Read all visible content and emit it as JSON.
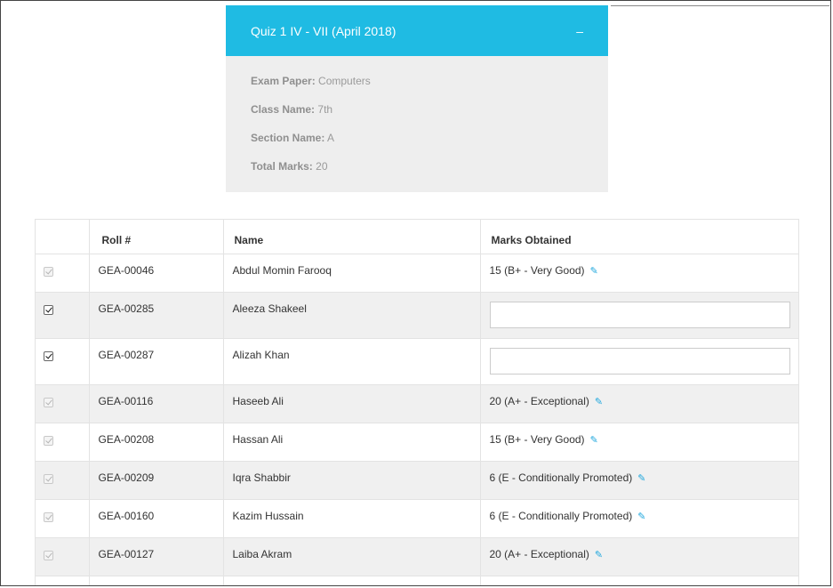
{
  "panel": {
    "title": "Quiz 1 IV - VII (April 2018)",
    "collapse_symbol": "–",
    "info": [
      {
        "label": "Exam Paper:",
        "value": "Computers"
      },
      {
        "label": "Class Name:",
        "value": "7th"
      },
      {
        "label": "Section Name:",
        "value": "A"
      },
      {
        "label": "Total Marks:",
        "value": "20"
      }
    ]
  },
  "table": {
    "headers": {
      "checkbox": "",
      "roll": "Roll #",
      "name": "Name",
      "marks": "Marks Obtained"
    },
    "rows": [
      {
        "roll": "GEA-00046",
        "name": "Abdul Momin Farooq",
        "marks": "15 (B+ - Very Good)",
        "editable": false,
        "checked": true
      },
      {
        "roll": "GEA-00285",
        "name": "Aleeza Shakeel",
        "marks": "",
        "editable": true,
        "checked": true
      },
      {
        "roll": "GEA-00287",
        "name": "Alizah Khan",
        "marks": "",
        "editable": true,
        "checked": true
      },
      {
        "roll": "GEA-00116",
        "name": "Haseeb Ali",
        "marks": "20 (A+ - Exceptional)",
        "editable": false,
        "checked": true
      },
      {
        "roll": "GEA-00208",
        "name": "Hassan Ali",
        "marks": "15 (B+ - Very Good)",
        "editable": false,
        "checked": true
      },
      {
        "roll": "GEA-00209",
        "name": "Iqra Shabbir",
        "marks": "6 (E - Conditionally Promoted)",
        "editable": false,
        "checked": true
      },
      {
        "roll": "GEA-00160",
        "name": "Kazim Hussain",
        "marks": "6 (E - Conditionally Promoted)",
        "editable": false,
        "checked": true
      },
      {
        "roll": "GEA-00127",
        "name": "Laiba Akram",
        "marks": "20 (A+ - Exceptional)",
        "editable": false,
        "checked": true
      }
    ]
  },
  "colors": {
    "panel_header": "#1fbbe3",
    "panel_body": "#eeeeee",
    "edit_icon": "#1fa7dd",
    "row_alt": "#f0f0f0"
  },
  "icons": {
    "edit": "pencil-icon",
    "collapse": "minus-icon"
  }
}
